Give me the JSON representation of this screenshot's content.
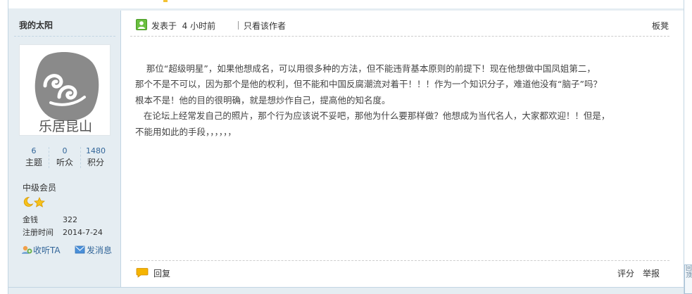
{
  "sidebar": {
    "username": "我的太阳",
    "avatar_text": "乐居昆山",
    "stats": [
      {
        "value": "6",
        "label": "主题"
      },
      {
        "value": "0",
        "label": "听众"
      },
      {
        "value": "1480",
        "label": "积分"
      }
    ],
    "grade": "中级会员",
    "money_label": "金钱",
    "money_value": "322",
    "regtime_label": "注册时间",
    "regtime_value": "2014-7-24",
    "follow_label": "收听TA",
    "message_label": "发消息"
  },
  "post": {
    "posted_prefix": "发表于",
    "posted_time": "4 小时前",
    "only_author": "只看该作者",
    "floor": "板凳",
    "content_lines": [
      "    那位“超级明星”，如果他想成名，可以用很多种的方法，但不能违背基本原则的前提下！现在他想做中国凤姐第二，",
      "那个不是不可以，因为那个是他的权利，但不能和中国反腐潮流对着干！！！作为一个知识分子，难道他没有“脑子”吗？",
      "根本不是！他的目的很明确，就是想炒作自己，提高他的知名度。",
      "   在论坛上经常发自己的照片，那个行为应该说不妥吧，那他为什么要那样做？他想成为当代名人，大家都欢迎！！但是，",
      "不能用如此的手段，，，，，，"
    ],
    "reply_label": "回复",
    "rate_label": "评分",
    "report_label": "举报"
  },
  "scroll_widget": {
    "chars": [
      "回",
      "顶"
    ]
  },
  "colors": {
    "sidebar_bg": "#e5edf2",
    "border": "#c2d5e3",
    "link": "#336699",
    "text": "#333333"
  }
}
